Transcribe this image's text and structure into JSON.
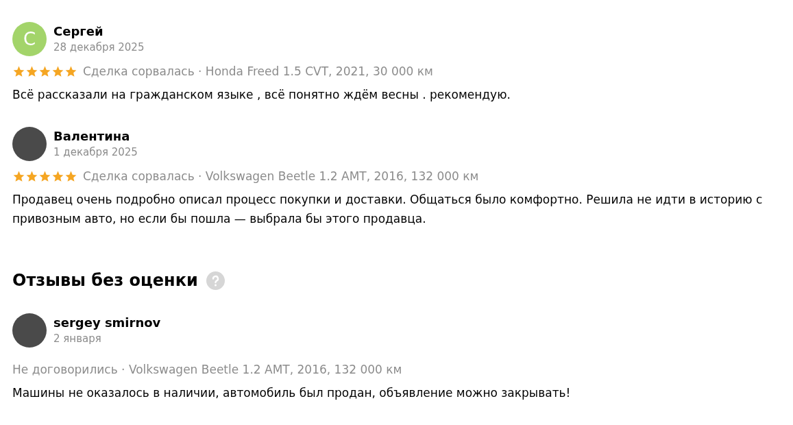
{
  "reviews": [
    {
      "author": "Сергей",
      "avatar": {
        "kind": "letter",
        "letter": "С",
        "color": "#a3d46a"
      },
      "date": "28 декабря 2025",
      "stars": 5,
      "meta": "Сделка сорвалась · Honda Freed 1.5 CVT, 2021, 30 000 км",
      "text": "Всё рассказали на гражданском языке , всё понятно ждём весны . рекомендую."
    },
    {
      "author": "Валентина",
      "avatar": {
        "kind": "photo"
      },
      "date": "1 декабря 2025",
      "stars": 5,
      "meta": "Сделка сорвалась · Volkswagen Beetle 1.2 AMT, 2016, 132 000 км",
      "text": "Продавец очень подробно описал процесс покупки и доставки. Общаться было комфортно. Решила не идти в историю с привозным авто, но если бы пошла — выбрала бы этого продавца."
    }
  ],
  "unrated": {
    "title": "Отзывы без оценки",
    "reviews": [
      {
        "author": "sergey smirnov",
        "avatar": {
          "kind": "photo"
        },
        "date": "2 января",
        "meta": "Не договорились · Volkswagen Beetle 1.2 AMT, 2016, 132 000 км",
        "text": "Машины не оказалось в наличии, автомобиль был продан, объявление можно закрывать!"
      }
    ]
  }
}
